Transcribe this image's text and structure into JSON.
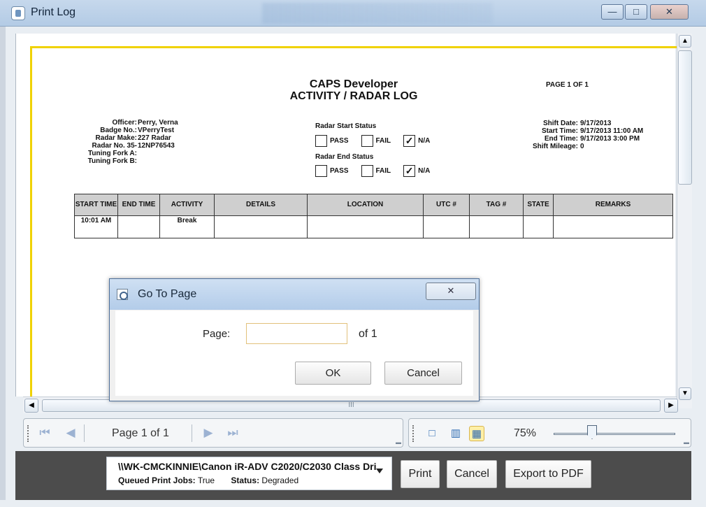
{
  "window": {
    "title": "Print Log",
    "minimize": "—",
    "maximize": "□",
    "close": "✕"
  },
  "report": {
    "title_line1": "CAPS Developer",
    "title_line2": "ACTIVITY / RADAR LOG",
    "page_label": "PAGE  1  OF  1",
    "officer_labels": [
      "Officer:",
      "Badge No.:",
      "Radar Make:",
      "Radar No. 35-",
      "Tuning Fork A:",
      "Tuning Fork B:"
    ],
    "officer_values": [
      "Perry, Verna",
      "VPerryTest",
      "227 Radar",
      "12NP76543",
      "",
      ""
    ],
    "radar_start_status": "Radar Start Status",
    "radar_end_status": "Radar End Status",
    "pass": "PASS",
    "fail": "FAIL",
    "na": "N/A",
    "shift_labels": [
      "Shift Date:",
      "Start Time:",
      "End Time:",
      "Shift Mileage:"
    ],
    "shift_values": [
      "9/17/2013",
      "9/17/2013 11:00 AM",
      "9/17/2013 3:00 PM",
      "0"
    ],
    "table": {
      "headers": [
        "START TIME",
        "END TIME",
        "ACTIVITY",
        "DETAILS",
        "LOCATION",
        "UTC #",
        "TAG #",
        "STATE",
        "REMARKS"
      ],
      "rows": [
        [
          "10:01 AM",
          "",
          "Break",
          "",
          "",
          "",
          "",
          "",
          ""
        ]
      ]
    }
  },
  "scrollbar": {
    "grip": "III"
  },
  "navigation": {
    "page_indicator": "Page 1 of 1"
  },
  "view": {
    "zoom": "75%"
  },
  "printer": {
    "name": "\\\\WK-CMCKINNIE\\Canon iR-ADV C2020/C2030 Class Dri",
    "queued_label": "Queued Print Jobs:",
    "queued_value": "True",
    "status_label": "Status:",
    "status_value": "Degraded"
  },
  "footer_buttons": {
    "print": "Print",
    "cancel": "Cancel",
    "export": "Export to PDF"
  },
  "dialog": {
    "title": "Go To Page",
    "page_label": "Page:",
    "page_value": "",
    "of_label": "of 1",
    "ok": "OK",
    "cancel": "Cancel"
  },
  "icons": {
    "first": "first-page-icon",
    "prev": "previous-page-icon",
    "next": "next-page-icon",
    "last": "last-page-icon",
    "single": "single-page-icon",
    "two": "two-page-icon",
    "grid": "grid-page-icon"
  }
}
